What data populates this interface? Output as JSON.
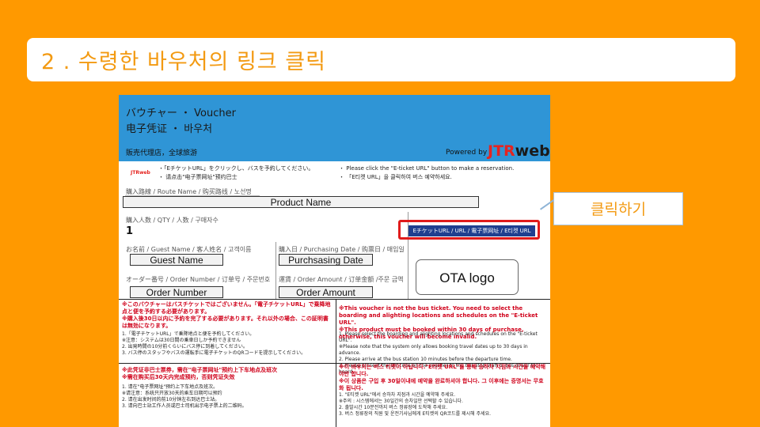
{
  "slide": {
    "title": "2 . 수령한 바우처의 링크 클릭",
    "callout": "클릭하기",
    "colors": {
      "background": "#FF9900",
      "accent_text": "#F39A12",
      "highlight": "#E01B1B",
      "voucher_header": "#2F95D6"
    }
  },
  "voucher": {
    "header_line1": "バウチャー ・ Voucher",
    "header_line2": "电子凭证 ・ 바우처",
    "agency": "販売代理店，全球旅游",
    "powered_by": "Powered by",
    "jtr_red": "JTR",
    "jtr_black": "web",
    "jtr_small": "JTRweb",
    "notice_jp": "・「EチケットURL」をクリックし、バスを予約してください。",
    "notice_cn": "・ 请点击\"电子票网址\"预约巴士",
    "notice_en": "・ Please click the \"E-ticket URL\" button to make a reservation.",
    "notice_kr": "・ 「E티켓 URL」을 클릭하여 버스 예약하세요.",
    "route_label": "購入路線 / Route Name / 购买路线 / 노선명",
    "product_name": "Product Name",
    "qty_label": "購入人数 / QTY / 人数 / 구매자수",
    "qty_value": "1",
    "eticket_button": "EチケットURL / URL / 電子票网址 / E티켓 URL",
    "guest_label": "お名前 / Guest Name / 客人姓名 / 고객이름",
    "guest_name": "Guest Name",
    "date_label": "購入日 / Purchasing Date / 购票日 / 매입일",
    "purchasing_date": "Purchsasing Date",
    "order_label": "オーダー番号 / Order Number / 订单号 / 주문번호",
    "order_number": "Order Number",
    "amount_label": "運賃 / Order Amount / 订单金额 /주문 금액",
    "order_amount": "Order Amount",
    "ota_logo": "OTA logo",
    "jp_red": "※このバウチャーはバスチケットではございません。「電子チケットURL」で乗降地点と便を予約する必要があります。\n※購入後30日以内に予約を完了する必要があります。それ以外の場合、この証明書は無効になります。",
    "jp_list": "1.「電子チケットURL」で乗降地点と便を予約してください。\n  ※注意：システムは30日間の乗車日しか予約できません\n2. 出発時間の10分前くらいにバス停に到着してください。\n3. バス停のスタッフやバスの運転手に電子チケットのQRコードを提示してください。",
    "en_red": "※This voucher is not the bus ticket. You need to select the boarding and alighting locations and schedules on the \"E-ticket URL\".\n※This product must be booked within 30 days of purchase, otherwise, this voucher will become invalid.",
    "en_list": "1. Please select the boarding and alighting locations and schedules on the \"E-ticket URL\".\n  ※Please note that the system only allows booking travel dates up to 30 days in advance.\n2. Please arrive at the bus station 10 minutes before the departure time.\n3. Please present the QR code on the voucher to the bus stop staff or bus driver to board.",
    "cn_red": "※此凭证非巴士票券，需在\"电子票网址\"预约上下车地点及班次\n※需在购买后30天内完成预约，否则凭证失效",
    "cn_list": "1. 请在\"电子票网址\"预约上下车地点及班次。\n  ※请注意：系统只开放30天的乘车日期可以预约\n2. 请在出发时间的前10分钟左右到达巴士站。\n3. 请向巴士站工作人员或巴士司机出示电子票上的二维码。",
    "kr_red": "※이 바우처는 버스 티켓이 아닙니다.\"E티켓 URL\"을 통해 승하차 지점과 시간을 예약해야만 합니다.\n※이 상품은 구입 후 30일이내에 예약을 완료하셔야 합니다. 그 이후에는 증명서는 무효화 됩니다.",
    "kr_list": "1. \"E티켓 URL\"에서 승하차 지점과 시간을 예약해 주세요.\n  ※주의 : 시스템에서는 30일간의 승차일만 선택할 수 있습니다.\n2. 출발시간 10분전까지 버스 정류장에 도착해 주세요.\n3. 버스 정류장의 직원 및 운전기사님에게 E티켓의 QR코드를 제시해 주세요."
  }
}
